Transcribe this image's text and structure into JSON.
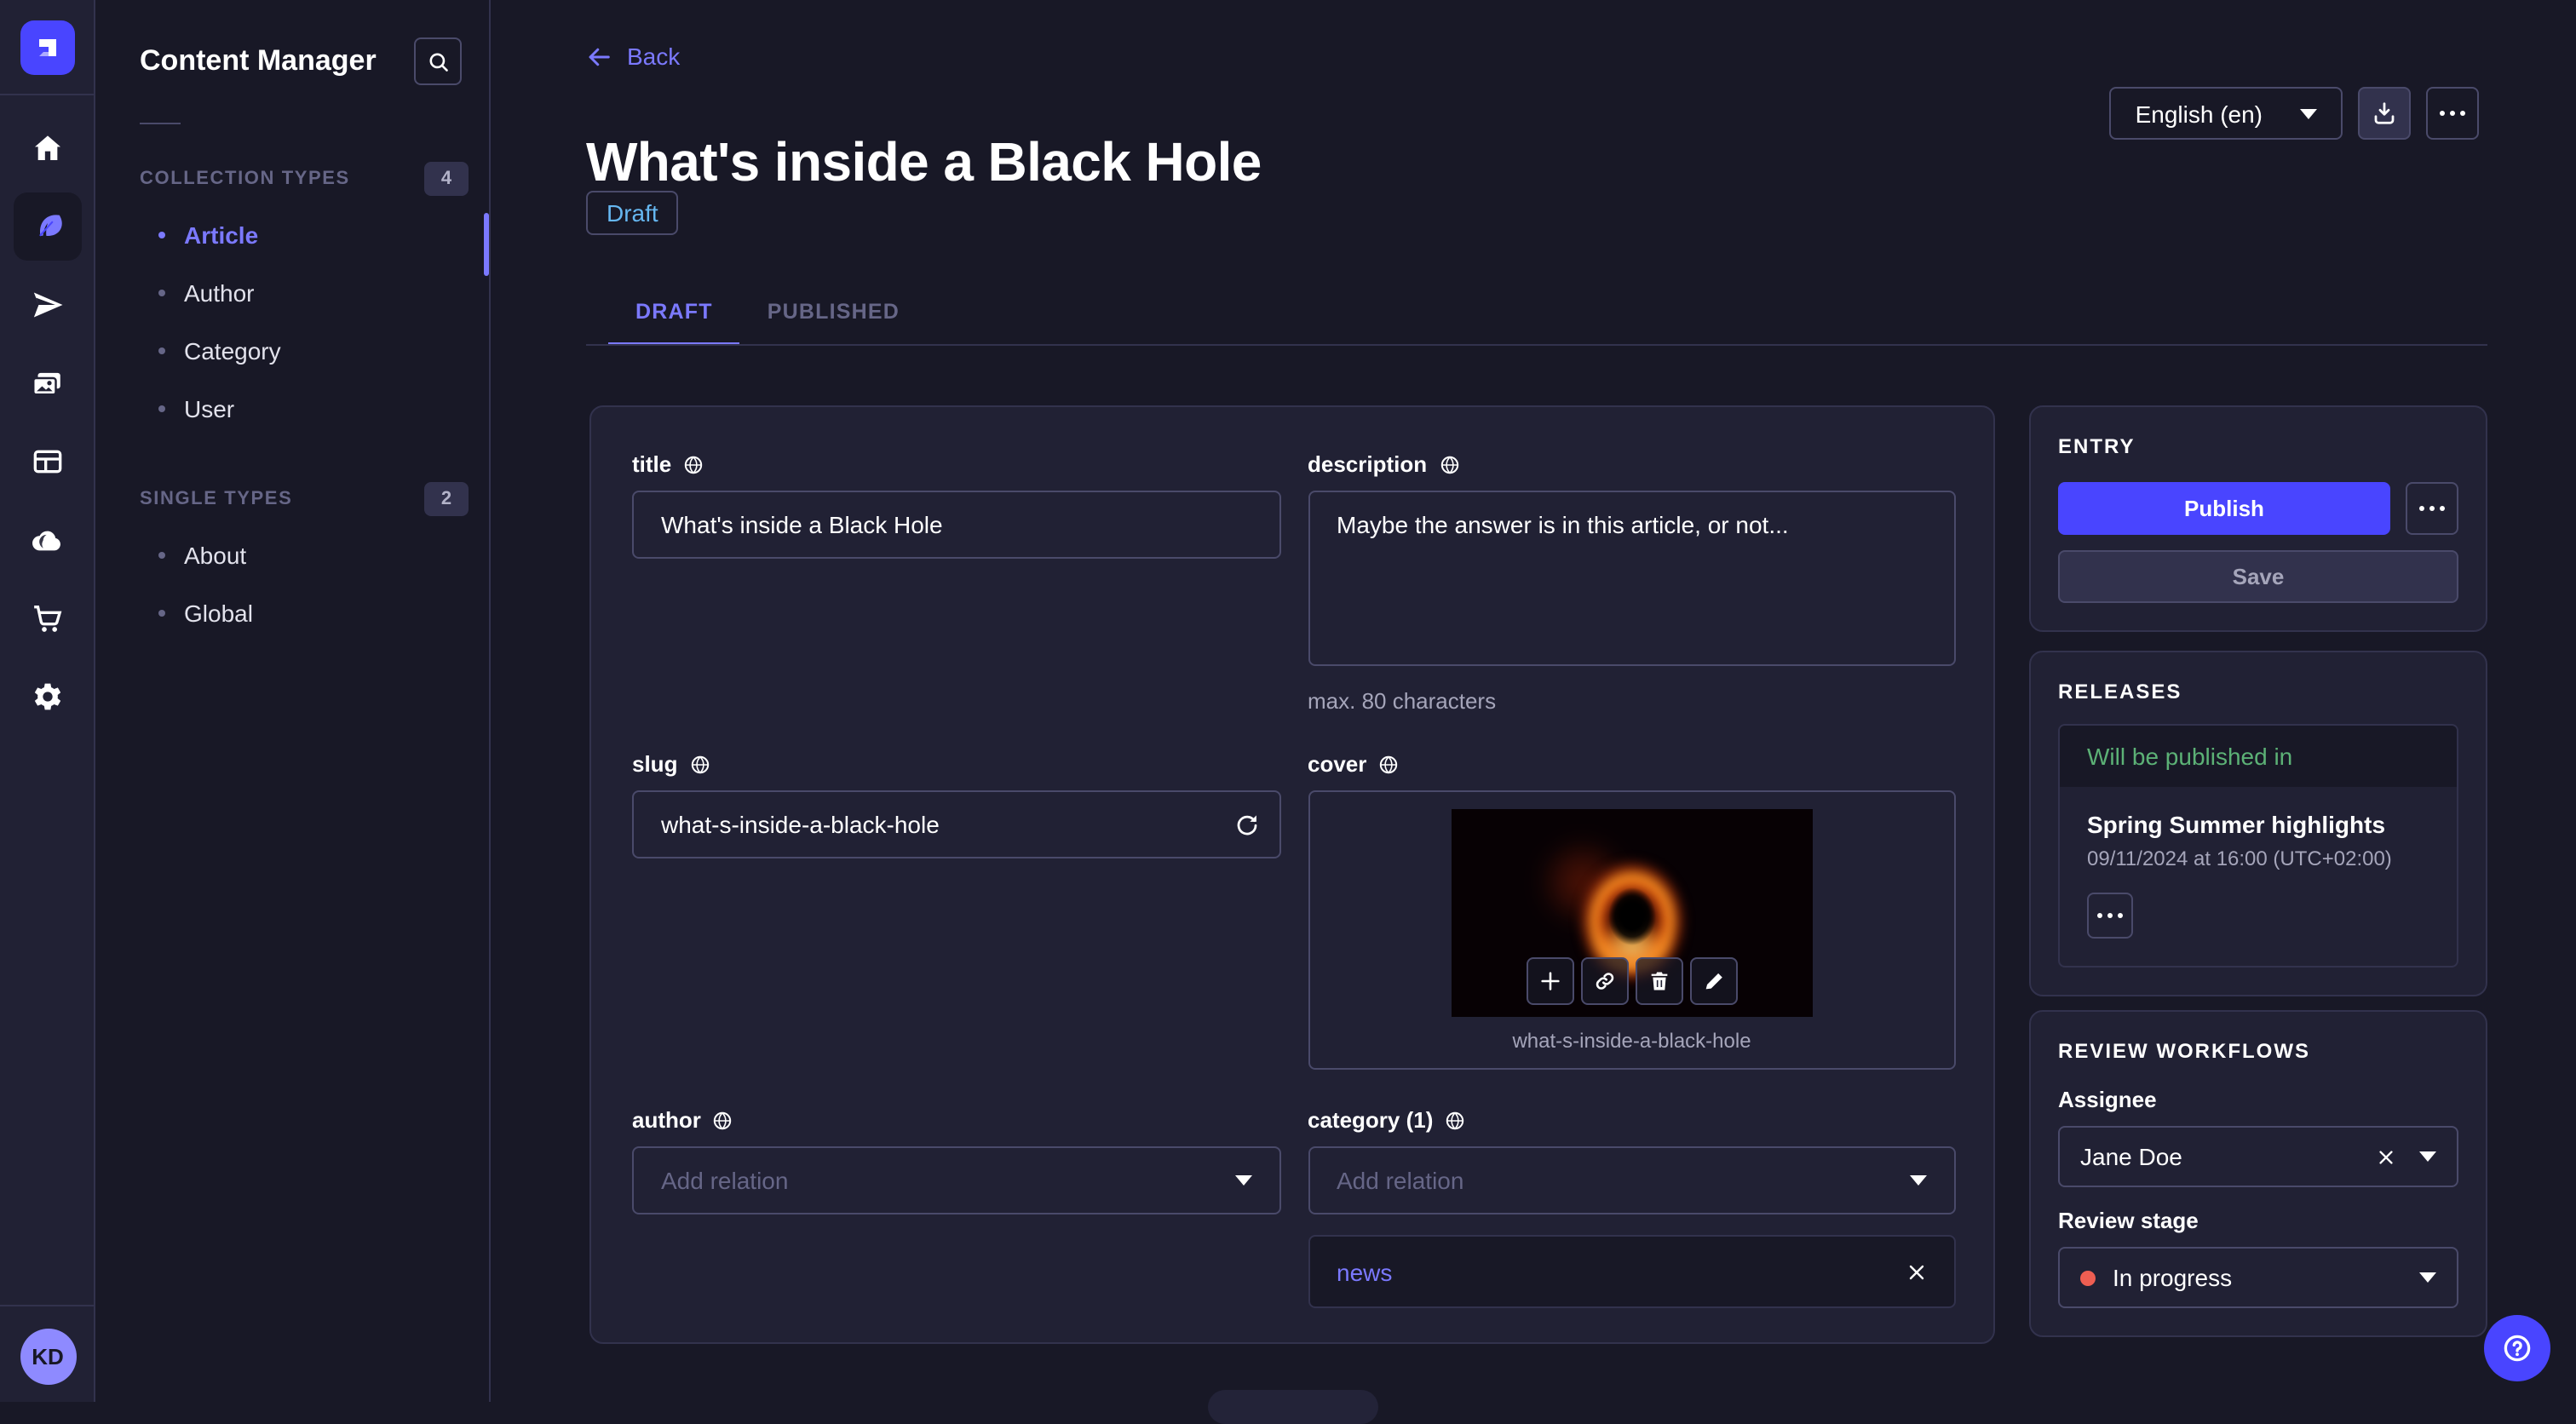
{
  "colors": {
    "accent": "#4945ff",
    "accent_light": "#7b79ff",
    "success_green": "#5cb176",
    "danger_red": "#ee5e52",
    "draft_blue": "#66b7f1",
    "card_bg": "#212134",
    "app_bg": "#181826"
  },
  "nav": {
    "avatar_initials": "KD",
    "icons": [
      "strapi-logo",
      "home",
      "content-manager-feather",
      "paper-plane",
      "media-library",
      "content-type-builder",
      "cloud",
      "marketplace-cart",
      "settings-gear"
    ]
  },
  "subnav": {
    "title": "Content Manager",
    "collection_types": {
      "label": "COLLECTION TYPES",
      "count": "4",
      "items": [
        {
          "label": "Article",
          "active": true
        },
        {
          "label": "Author"
        },
        {
          "label": "Category"
        },
        {
          "label": "User"
        }
      ]
    },
    "single_types": {
      "label": "SINGLE TYPES",
      "count": "2",
      "items": [
        {
          "label": "About"
        },
        {
          "label": "Global"
        }
      ]
    }
  },
  "header": {
    "back_label": "Back",
    "title": "What's inside a Black Hole",
    "status_badge": "Draft",
    "locale": "English (en)",
    "tabs": [
      {
        "label": "DRAFT",
        "active": true
      },
      {
        "label": "PUBLISHED",
        "active": false
      }
    ]
  },
  "form": {
    "title": {
      "label": "title",
      "value": "What's inside a Black Hole"
    },
    "description": {
      "label": "description",
      "value": "Maybe the answer is in this article, or not...",
      "hint": "max. 80 characters"
    },
    "slug": {
      "label": "slug",
      "value": "what-s-inside-a-black-hole"
    },
    "cover": {
      "label": "cover",
      "caption": "what-s-inside-a-black-hole"
    },
    "author": {
      "label": "author",
      "placeholder": "Add relation"
    },
    "category": {
      "label": "category (1)",
      "placeholder": "Add relation",
      "relations": [
        {
          "label": "news"
        }
      ]
    }
  },
  "entry_panel": {
    "heading": "ENTRY",
    "publish_label": "Publish",
    "save_label": "Save"
  },
  "releases_panel": {
    "heading": "RELEASES",
    "status": "Will be published in",
    "release_name": "Spring Summer highlights",
    "release_date": "09/11/2024 at 16:00 (UTC+02:00)"
  },
  "review_panel": {
    "heading": "REVIEW WORKFLOWS",
    "assignee_label": "Assignee",
    "assignee_value": "Jane Doe",
    "stage_label": "Review stage",
    "stage_value": "In progress"
  }
}
